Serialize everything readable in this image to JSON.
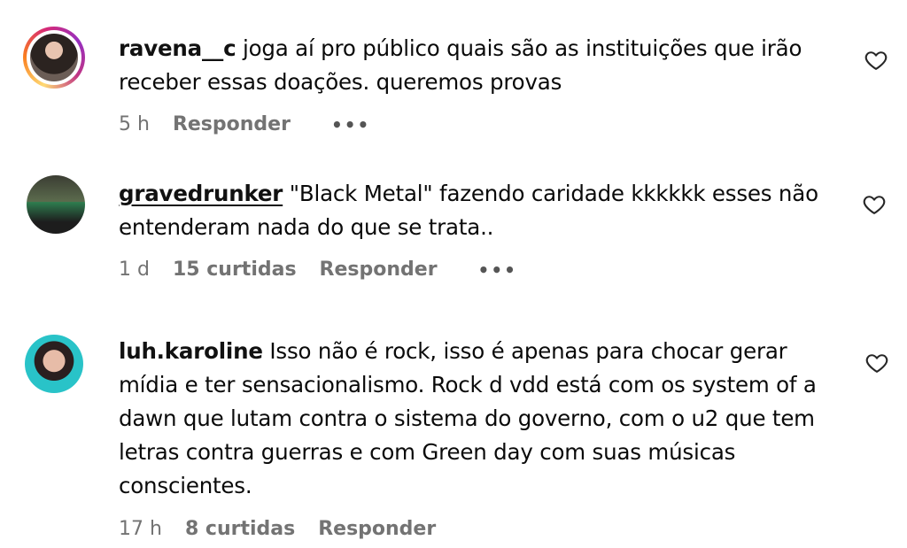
{
  "comments": [
    {
      "username": "ravena__c",
      "text": "joga aí pro público quais são as instituições que irão receber essas doações. queremos provas",
      "time": "5 h",
      "likes": "",
      "reply_label": "Responder",
      "more_label": "•••",
      "has_story_ring": true
    },
    {
      "username": "gravedrunker",
      "text": "\"Black Metal\" fazendo caridade kkkkkk esses não entenderam nada do que se trata..",
      "time": "1 d",
      "likes": "15 curtidas",
      "reply_label": "Responder",
      "more_label": "•••",
      "has_story_ring": false
    },
    {
      "username": "luh.karoline",
      "text": "Isso não é rock, isso é apenas para chocar gerar mídia e ter sensacionalismo. Rock d vdd está com os system of a dawn que lutam contra o sistema do governo, com o u2 que tem letras contra guerras e com Green day com suas músicas conscientes.",
      "time": "17 h",
      "likes": "8 curtidas",
      "reply_label": "Responder",
      "more_label": "",
      "has_story_ring": false
    }
  ],
  "icons": {
    "like": "heart-outline-icon",
    "more": "more-horizontal-icon"
  },
  "colors": {
    "text": "#0a0a0a",
    "meta": "#737373",
    "ring": "#d62976"
  }
}
